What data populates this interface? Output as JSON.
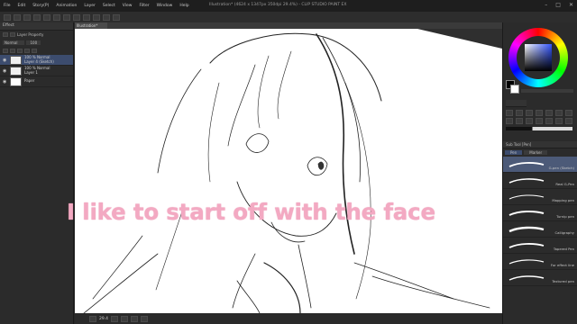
{
  "app": {
    "title": "Illustration* (4624 x 1347px 350dpi 29.4%) - CLIP STUDIO PAINT EX",
    "window_controls": [
      "minimize-icon",
      "maximize-icon",
      "close-icon"
    ]
  },
  "menu": [
    "File",
    "Edit",
    "Story(P)",
    "Animation",
    "Layer",
    "Select",
    "View",
    "Filter",
    "Window",
    "Help"
  ],
  "left_panel": {
    "tabs": [
      "Effect",
      "Layer Property",
      "Layer"
    ],
    "blend_mode": "Normal",
    "opacity": "100",
    "layers": [
      {
        "name": "100 % Normal\nLayer 4 (Sketch)",
        "selected": true
      },
      {
        "name": "100 % Normal\nLayer 1",
        "selected": false
      },
      {
        "name": "Paper",
        "selected": false
      }
    ]
  },
  "canvas": {
    "doc_tab": "Illustration*",
    "zoom": "29.4",
    "caption": "I like to start off with the face"
  },
  "right_panel": {
    "sub_tool_title": "Sub Tool [Pen]",
    "sub_tool_tabs": [
      "Pen",
      "Marker"
    ],
    "brushes": [
      {
        "name": "G-pen (Sketch)",
        "selected": true
      },
      {
        "name": "Real G-Pen",
        "selected": false
      },
      {
        "name": "Mapping pen",
        "selected": false
      },
      {
        "name": "Turnip pen",
        "selected": false
      },
      {
        "name": "Calligraphy",
        "selected": false
      },
      {
        "name": "Tapered Pen",
        "selected": false
      },
      {
        "name": "For effect line",
        "selected": false
      },
      {
        "name": "Textured pen",
        "selected": false
      }
    ],
    "colors": {
      "main": "#000000",
      "sub": "#ffffff"
    }
  },
  "accent_color": "#f3a9c2"
}
